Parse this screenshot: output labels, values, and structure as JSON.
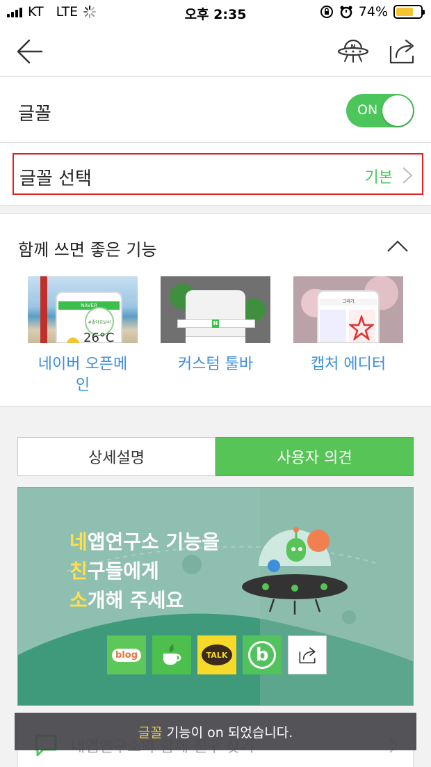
{
  "status_bar": {
    "carrier": "KT",
    "network": "LTE",
    "time": "오후 2:35",
    "battery": "74%"
  },
  "nav": {
    "back_icon": "back-arrow-icon",
    "lab_icon": "naver-lab-ufo-icon",
    "share_icon": "share-icon"
  },
  "font_toggle": {
    "label": "글꼴",
    "state": "ON",
    "accent": "#4cc65b"
  },
  "font_select": {
    "label": "글꼴 선택",
    "value": "기본"
  },
  "features": {
    "title": "함께 쓰면 좋은 기능",
    "items": [
      {
        "label": "네이버 오픈메\n인",
        "thumb_text_1": "NAVER",
        "thumb_text_2": "#좋아요날씨",
        "thumb_temp": "26°C"
      },
      {
        "label": "커스텀 툴바",
        "thumb_text_1": "N"
      },
      {
        "label": "캡처 에디터",
        "thumb_text_1": "그리기"
      }
    ]
  },
  "tabs": {
    "detail": "상세설명",
    "feedback": "사용자 의견"
  },
  "banner": {
    "line1_highlight": "네",
    "line1_rest": "앱연구소 기능을",
    "line2_highlight": "친",
    "line2_rest": "구들에게",
    "line3_highlight": "소",
    "line3_rest": "개해 주세요",
    "share_buttons": [
      {
        "name": "blog",
        "label": "blog",
        "color": "#5ec75a"
      },
      {
        "name": "cafe",
        "label": "",
        "color": "#4cbf4c"
      },
      {
        "name": "kakaotalk",
        "label": "TALK",
        "color": "#f7d92a"
      },
      {
        "name": "band",
        "label": "b",
        "color": "#52c25c"
      },
      {
        "name": "share",
        "label": "",
        "color": "#ffffff"
      }
    ]
  },
  "bottom_card": {
    "text": "네앱연구소와 함께 친구 찾기"
  },
  "toast": {
    "highlight": "글꼴",
    "rest": " 기능이 on 되었습니다."
  }
}
